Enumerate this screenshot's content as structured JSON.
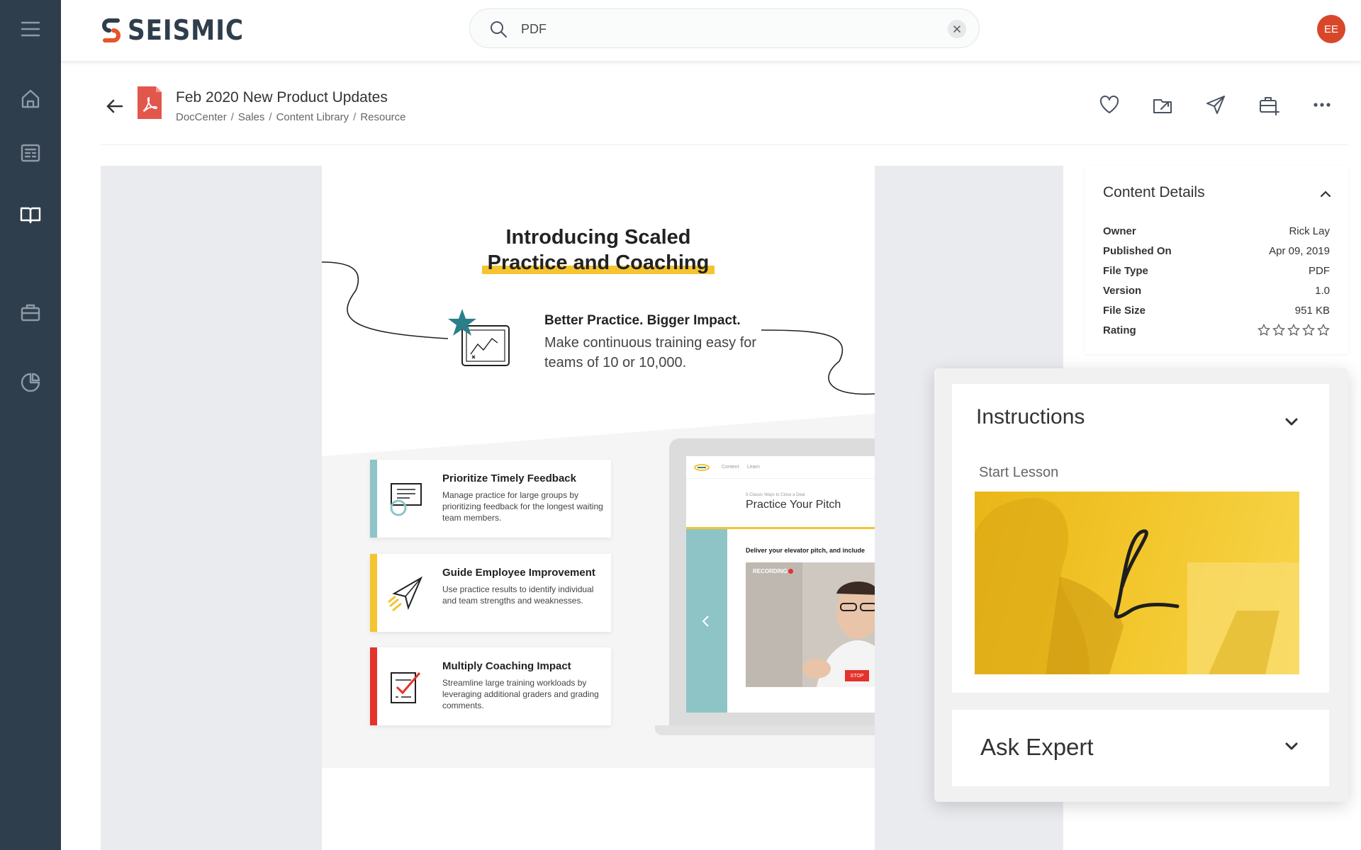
{
  "brand": {
    "name": "SEISMIC",
    "accent": "#d9472b",
    "sidebar_bg": "#2f3e4c",
    "highlight": "#f4c431"
  },
  "search": {
    "value": "PDF",
    "placeholder": "Search"
  },
  "user": {
    "initials": "EE"
  },
  "sidebar": {
    "items": [
      {
        "name": "menu",
        "icon": "hamburger-icon"
      },
      {
        "name": "home",
        "icon": "home-icon"
      },
      {
        "name": "news",
        "icon": "newspaper-icon"
      },
      {
        "name": "library",
        "icon": "book-icon",
        "active": true
      },
      {
        "name": "workspace",
        "icon": "briefcase-icon"
      },
      {
        "name": "analytics",
        "icon": "pie-chart-icon"
      }
    ]
  },
  "document": {
    "title": "Feb 2020 New Product Updates",
    "breadcrumb": [
      "DocCenter",
      "Sales",
      "Content Library",
      "Resource"
    ],
    "file_icon": "pdf-icon"
  },
  "actions": [
    "heart-icon",
    "export-icon",
    "send-icon",
    "briefcase-add-icon",
    "more-icon"
  ],
  "page": {
    "title_line1": "Introducing Scaled",
    "title_line2": "Practice and Coaching",
    "intro_heading": "Better Practice. Bigger Impact.",
    "intro_text": "Make continuous training easy for teams of 10 or 10,000.",
    "cards": [
      {
        "title": "Prioritize Timely Feedback",
        "text": "Manage practice for large groups by prioritizing feedback for the longest waiting team members.",
        "color": "#8fc4c7"
      },
      {
        "title": "Guide Employee Improvement",
        "text": "Use practice results to identify individual and team strengths and weaknesses.",
        "color": "#f4c431"
      },
      {
        "title": "Multiply Coaching Impact",
        "text": "Streamline large training workloads by leveraging additional graders and grading comments.",
        "color": "#e3332c"
      }
    ],
    "screen": {
      "nav1": "Content",
      "nav2": "Learn",
      "subtitle": "5 Classic Ways to Close a Deal",
      "title": "Practice Your Pitch",
      "prompt": "Deliver your elevator pitch, and include",
      "recording": "RECORDING",
      "stop": "STOP"
    }
  },
  "details": {
    "title": "Content Details",
    "rows": [
      {
        "label": "Owner",
        "value": "Rick Lay"
      },
      {
        "label": "Published On",
        "value": "Apr 09, 2019"
      },
      {
        "label": "File Type",
        "value": "PDF"
      },
      {
        "label": "Version",
        "value": "1.0"
      },
      {
        "label": "File Size",
        "value": "951 KB"
      },
      {
        "label": "Rating",
        "value": ""
      }
    ],
    "rating": {
      "value": 0,
      "max": 5
    }
  },
  "instructions": {
    "title": "Instructions",
    "lesson_label": "Start Lesson"
  },
  "ask_expert": {
    "title": "Ask Expert"
  }
}
